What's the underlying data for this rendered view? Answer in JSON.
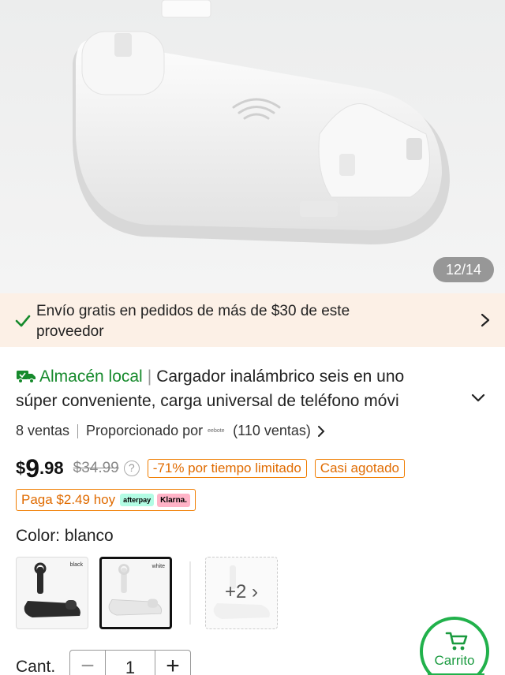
{
  "gallery": {
    "counter": "12/14"
  },
  "shipping": {
    "text": "Envío gratis en pedidos de más de $30 de este proveedor",
    "icon": "check-icon",
    "accent": "#168a2c"
  },
  "product": {
    "badge": "Almacén local",
    "title_line1": "Cargador inalámbrico seis en uno",
    "title_line2": "súper conveniente, carga universal de teléfono móvi",
    "sales": "8 ventas",
    "provided_by": "Proporcionado por",
    "seller_logo": "eebote",
    "seller_sales": "(110 ventas)"
  },
  "price": {
    "currency": "$",
    "integer": "9",
    "decimal": ".98",
    "original": "$34.99",
    "help": "?",
    "discount_tag": "-71% por tiempo limitado",
    "stock_tag": "Casi agotado",
    "accent": "#f07d00"
  },
  "pay_later": {
    "text": "Paga $2.49 hoy",
    "afterpay": "afterpay",
    "klarna": "Klarna."
  },
  "color": {
    "label": "Color: blanco",
    "options": [
      {
        "label": "black"
      },
      {
        "label": "white"
      }
    ],
    "more": "+2"
  },
  "quantity": {
    "label": "Cant.",
    "minus": "−",
    "value": "1",
    "plus": "+"
  },
  "cart": {
    "label": "Carrito",
    "accent": "#21b14b"
  }
}
